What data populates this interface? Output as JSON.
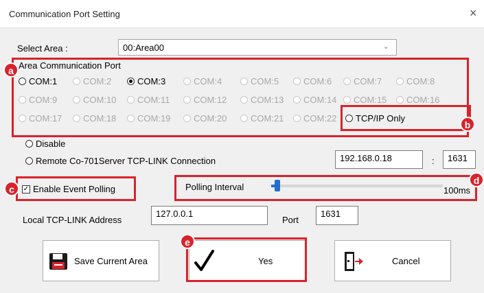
{
  "window": {
    "title": "Communication Port Setting",
    "close_glyph": "×"
  },
  "area": {
    "label": "Select Area :",
    "value": "00:Area00",
    "arrow": "⌄"
  },
  "port_group": {
    "title": "Area Communication Port",
    "ports": [
      "COM:1",
      "COM:2",
      "COM:3",
      "COM:4",
      "COM:5",
      "COM:6",
      "COM:7",
      "COM:8",
      "COM:9",
      "COM:10",
      "COM:11",
      "COM:12",
      "COM:13",
      "COM:14",
      "COM:15",
      "COM:16",
      "COM:17",
      "COM:18",
      "COM:19",
      "COM:20",
      "COM:21",
      "COM:22"
    ],
    "selected": "COM:3",
    "tcpip_only": "TCP/IP Only",
    "disable": "Disable",
    "remote": "Remote Co-701Server TCP-LINK Connection",
    "remote_ip": "192.168.0.18",
    "separator": ":",
    "remote_port": "1631"
  },
  "polling": {
    "enable_label": "Enable Event Polling",
    "enabled": true,
    "interval_label": "Polling Interval",
    "interval_value": "100ms",
    "slider_fraction": 0.02
  },
  "local": {
    "address_label": "Local TCP-LINK Address",
    "address_value": "127.0.0.1",
    "port_label": "Port",
    "port_value": "1631"
  },
  "buttons": {
    "save": "Save Current Area",
    "yes": "Yes",
    "cancel": "Cancel"
  },
  "callouts": {
    "a": "a",
    "b": "b",
    "c": "c",
    "d": "d",
    "e": "e"
  },
  "colors": {
    "callout_red": "#d9222a",
    "slider_blue": "#1f6fd0"
  }
}
